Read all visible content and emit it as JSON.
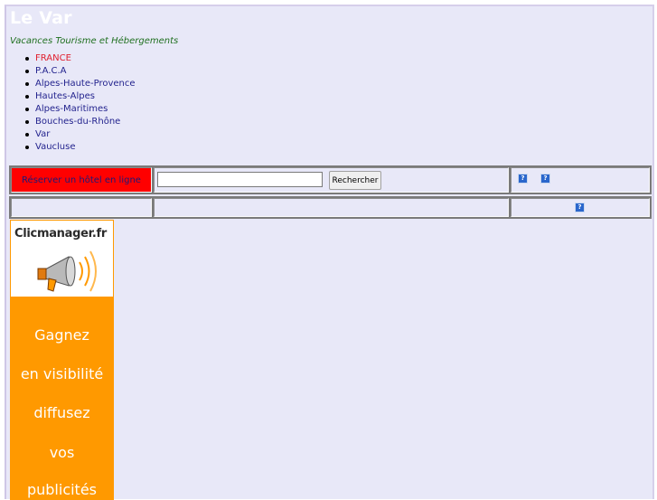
{
  "header": {
    "title": "Le Var",
    "subtitle": "Vacances Tourisme et Hébergements"
  },
  "nav": {
    "items": [
      {
        "label": "FRANCE",
        "active": true
      },
      {
        "label": "P.A.C.A"
      },
      {
        "label": "Alpes-Haute-Provence"
      },
      {
        "label": "Hautes-Alpes"
      },
      {
        "label": "Alpes-Maritimes"
      },
      {
        "label": "Bouches-du-Rhône"
      },
      {
        "label": "Var"
      },
      {
        "label": "Vaucluse"
      }
    ]
  },
  "booking": {
    "label": "Réserver un hôtel en ligne",
    "search_value": "",
    "button_label": "Rechercher"
  },
  "help": {
    "icon_glyph": "?",
    "icon_name": "help-icon"
  },
  "ad": {
    "brand": "Clicmanager.fr",
    "lines": [
      "Gagnez",
      "en visibilité",
      "diffusez",
      "vos",
      "publicités"
    ]
  },
  "colors": {
    "background": "#e8e8f8",
    "booking_bg": "#ff0000",
    "ad_bg": "#ff9900",
    "link": "#23238e",
    "active_link": "#e0202f",
    "subtitle": "#1f6f1f"
  }
}
